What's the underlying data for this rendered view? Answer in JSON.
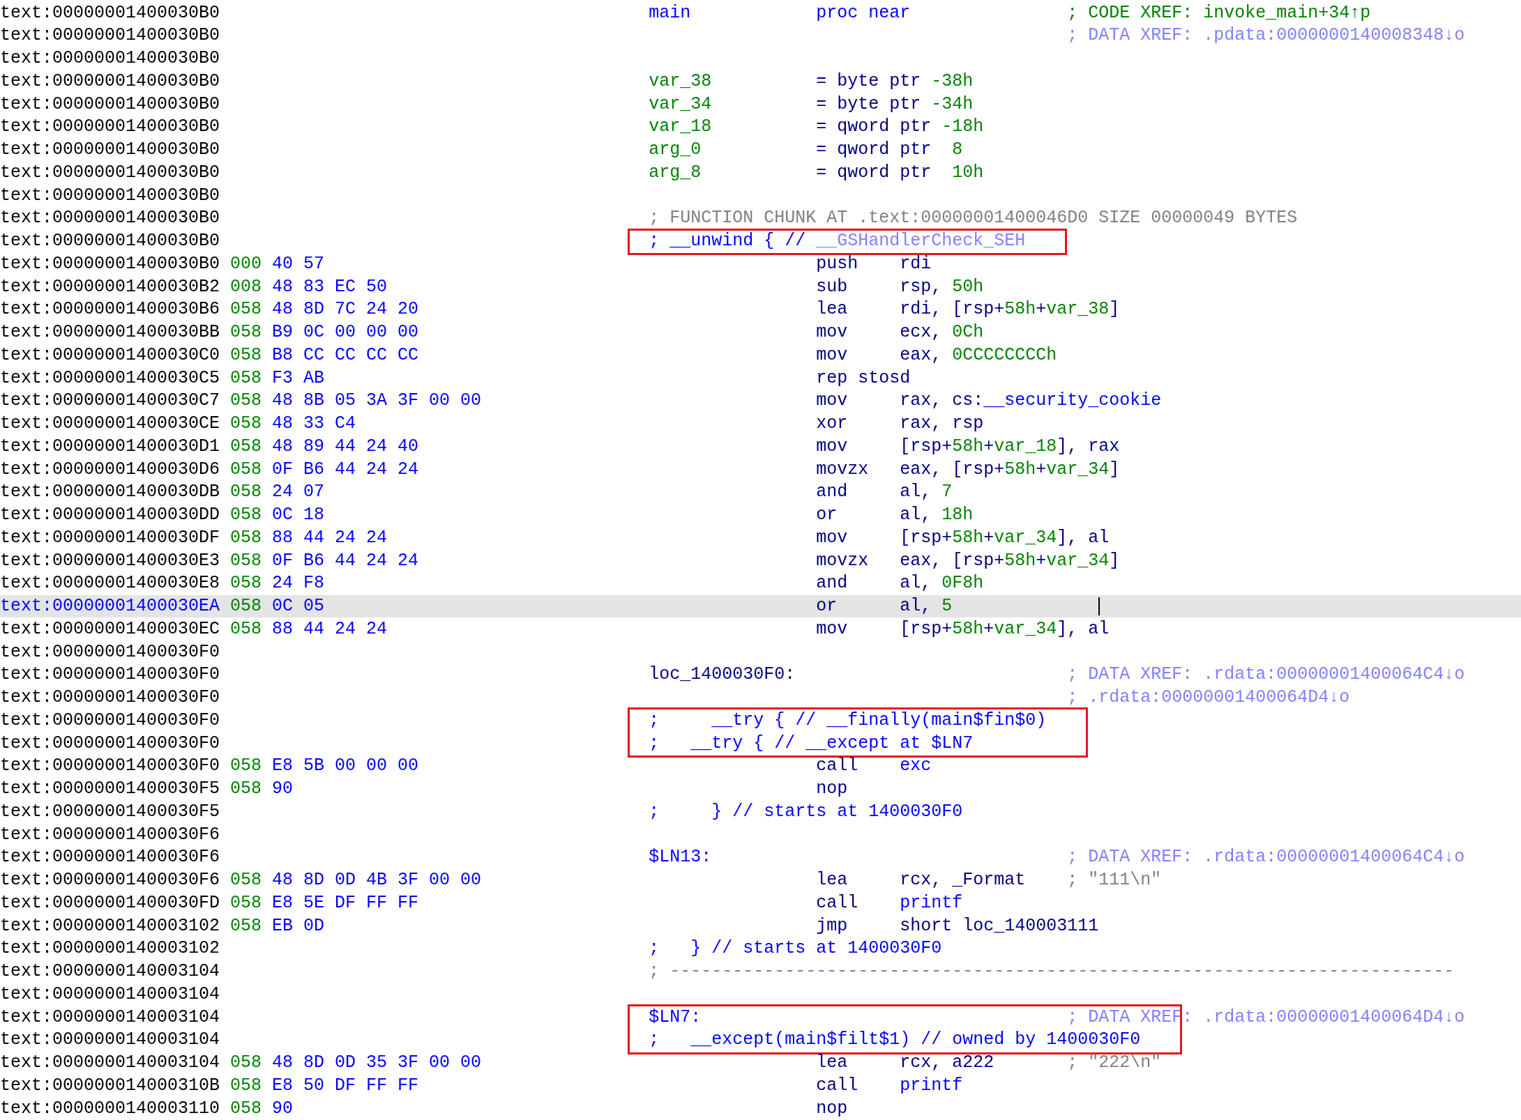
{
  "rows": [
    {
      "address": "text:00000001400030B0",
      "label": [
        {
          "text": "main",
          "kind": "name"
        }
      ],
      "operands": [
        {
          "text": "proc near",
          "kind": "name"
        }
      ],
      "comment": [
        {
          "text": "; CODE XREF: invoke_main+34↑p",
          "kind": "num"
        }
      ],
      "selected": false,
      "boxed": false
    },
    {
      "address": "text:00000001400030B0",
      "comment": [
        {
          "text": "; DATA XREF: .pdata:0000000140008348↓o",
          "kind": "xref"
        }
      ],
      "selected": false,
      "boxed": false
    },
    {
      "address": "text:00000001400030B0",
      "selected": false,
      "boxed": false
    },
    {
      "address": "text:00000001400030B0",
      "label": [
        {
          "text": "var_38",
          "kind": "num"
        }
      ],
      "operands": [
        {
          "text": "= byte ptr ",
          "kind": "plain"
        },
        {
          "text": "-38h",
          "kind": "num"
        }
      ],
      "selected": false,
      "boxed": false
    },
    {
      "address": "text:00000001400030B0",
      "label": [
        {
          "text": "var_34",
          "kind": "num"
        }
      ],
      "operands": [
        {
          "text": "= byte ptr ",
          "kind": "plain"
        },
        {
          "text": "-34h",
          "kind": "num"
        }
      ],
      "selected": false,
      "boxed": false
    },
    {
      "address": "text:00000001400030B0",
      "label": [
        {
          "text": "var_18",
          "kind": "num"
        }
      ],
      "operands": [
        {
          "text": "= qword ptr ",
          "kind": "plain"
        },
        {
          "text": "-18h",
          "kind": "num"
        }
      ],
      "selected": false,
      "boxed": false
    },
    {
      "address": "text:00000001400030B0",
      "label": [
        {
          "text": "arg_0",
          "kind": "num"
        }
      ],
      "operands": [
        {
          "text": "= qword ptr  ",
          "kind": "plain"
        },
        {
          "text": "8",
          "kind": "num"
        }
      ],
      "selected": false,
      "boxed": false
    },
    {
      "address": "text:00000001400030B0",
      "label": [
        {
          "text": "arg_8",
          "kind": "num"
        }
      ],
      "operands": [
        {
          "text": "= qword ptr  ",
          "kind": "plain"
        },
        {
          "text": "10h",
          "kind": "num"
        }
      ],
      "selected": false,
      "boxed": false
    },
    {
      "address": "text:00000001400030B0",
      "selected": false,
      "boxed": false
    },
    {
      "address": "text:00000001400030B0",
      "label": [
        {
          "text": "; FUNCTION CHUNK AT .text:00000001400046D0 SIZE 00000049 BYTES",
          "kind": "gray"
        }
      ],
      "selected": false,
      "boxed": false
    },
    {
      "address": "text:00000001400030B0",
      "label": [
        {
          "text": "; __unwind { // ",
          "kind": "name"
        },
        {
          "text": "__GSHandlerCheck_SEH",
          "kind": "xref"
        }
      ],
      "selected": false,
      "boxed": true
    },
    {
      "address": "text:00000001400030B0",
      "stack": "000",
      "bytes": "40 57",
      "mnemonic": "push",
      "operands": [
        {
          "text": "rdi",
          "kind": "plain"
        }
      ],
      "selected": false,
      "boxed": false
    },
    {
      "address": "text:00000001400030B2",
      "stack": "008",
      "bytes": "48 83 EC 50",
      "mnemonic": "sub",
      "operands": [
        {
          "text": "rsp, ",
          "kind": "plain"
        },
        {
          "text": "50h",
          "kind": "num"
        }
      ],
      "selected": false,
      "boxed": false
    },
    {
      "address": "text:00000001400030B6",
      "stack": "058",
      "bytes": "48 8D 7C 24 20",
      "mnemonic": "lea",
      "operands": [
        {
          "text": "rdi, [rsp+",
          "kind": "plain"
        },
        {
          "text": "58h",
          "kind": "num"
        },
        {
          "text": "+",
          "kind": "plain"
        },
        {
          "text": "var_38",
          "kind": "num"
        },
        {
          "text": "]",
          "kind": "plain"
        }
      ],
      "selected": false,
      "boxed": false
    },
    {
      "address": "text:00000001400030BB",
      "stack": "058",
      "bytes": "B9 0C 00 00 00",
      "mnemonic": "mov",
      "operands": [
        {
          "text": "ecx, ",
          "kind": "plain"
        },
        {
          "text": "0Ch",
          "kind": "num"
        }
      ],
      "selected": false,
      "boxed": false
    },
    {
      "address": "text:00000001400030C0",
      "stack": "058",
      "bytes": "B8 CC CC CC CC",
      "mnemonic": "mov",
      "operands": [
        {
          "text": "eax, ",
          "kind": "plain"
        },
        {
          "text": "0CCCCCCCCh",
          "kind": "num"
        }
      ],
      "selected": false,
      "boxed": false
    },
    {
      "address": "text:00000001400030C5",
      "stack": "058",
      "bytes": "F3 AB",
      "mnemonic": "rep stosd",
      "selected": false,
      "boxed": false
    },
    {
      "address": "text:00000001400030C7",
      "stack": "058",
      "bytes": "48 8B 05 3A 3F 00 00",
      "mnemonic": "mov",
      "operands": [
        {
          "text": "rax, cs:",
          "kind": "plain"
        },
        {
          "text": "__security_cookie",
          "kind": "name"
        }
      ],
      "selected": false,
      "boxed": false
    },
    {
      "address": "text:00000001400030CE",
      "stack": "058",
      "bytes": "48 33 C4",
      "mnemonic": "xor",
      "operands": [
        {
          "text": "rax, rsp",
          "kind": "plain"
        }
      ],
      "selected": false,
      "boxed": false
    },
    {
      "address": "text:00000001400030D1",
      "stack": "058",
      "bytes": "48 89 44 24 40",
      "mnemonic": "mov",
      "operands": [
        {
          "text": "[rsp+",
          "kind": "plain"
        },
        {
          "text": "58h",
          "kind": "num"
        },
        {
          "text": "+",
          "kind": "plain"
        },
        {
          "text": "var_18",
          "kind": "num"
        },
        {
          "text": "], rax",
          "kind": "plain"
        }
      ],
      "selected": false,
      "boxed": false
    },
    {
      "address": "text:00000001400030D6",
      "stack": "058",
      "bytes": "0F B6 44 24 24",
      "mnemonic": "movzx",
      "operands": [
        {
          "text": "eax, [rsp+",
          "kind": "plain"
        },
        {
          "text": "58h",
          "kind": "num"
        },
        {
          "text": "+",
          "kind": "plain"
        },
        {
          "text": "var_34",
          "kind": "num"
        },
        {
          "text": "]",
          "kind": "plain"
        }
      ],
      "selected": false,
      "boxed": false
    },
    {
      "address": "text:00000001400030DB",
      "stack": "058",
      "bytes": "24 07",
      "mnemonic": "and",
      "operands": [
        {
          "text": "al, ",
          "kind": "plain"
        },
        {
          "text": "7",
          "kind": "num"
        }
      ],
      "selected": false,
      "boxed": false
    },
    {
      "address": "text:00000001400030DD",
      "stack": "058",
      "bytes": "0C 18",
      "mnemonic": "or",
      "operands": [
        {
          "text": "al, ",
          "kind": "plain"
        },
        {
          "text": "18h",
          "kind": "num"
        }
      ],
      "selected": false,
      "boxed": false
    },
    {
      "address": "text:00000001400030DF",
      "stack": "058",
      "bytes": "88 44 24 24",
      "mnemonic": "mov",
      "operands": [
        {
          "text": "[rsp+",
          "kind": "plain"
        },
        {
          "text": "58h",
          "kind": "num"
        },
        {
          "text": "+",
          "kind": "plain"
        },
        {
          "text": "var_34",
          "kind": "num"
        },
        {
          "text": "], al",
          "kind": "plain"
        }
      ],
      "selected": false,
      "boxed": false
    },
    {
      "address": "text:00000001400030E3",
      "stack": "058",
      "bytes": "0F B6 44 24 24",
      "mnemonic": "movzx",
      "operands": [
        {
          "text": "eax, [rsp+",
          "kind": "plain"
        },
        {
          "text": "58h",
          "kind": "num"
        },
        {
          "text": "+",
          "kind": "plain"
        },
        {
          "text": "var_34",
          "kind": "num"
        },
        {
          "text": "]",
          "kind": "plain"
        }
      ],
      "selected": false,
      "boxed": false
    },
    {
      "address": "text:00000001400030E8",
      "stack": "058",
      "bytes": "24 F8",
      "mnemonic": "and",
      "operands": [
        {
          "text": "al, ",
          "kind": "plain"
        },
        {
          "text": "0F8h",
          "kind": "num"
        }
      ],
      "selected": false,
      "boxed": false
    },
    {
      "address": "text:00000001400030EA",
      "stack": "058",
      "bytes": "0C 05",
      "mnemonic": "or",
      "operands": [
        {
          "text": "al, ",
          "kind": "plain"
        },
        {
          "text": "5",
          "kind": "num"
        }
      ],
      "selected": true,
      "boxed": false
    },
    {
      "address": "text:00000001400030EC",
      "stack": "058",
      "bytes": "88 44 24 24",
      "mnemonic": "mov",
      "operands": [
        {
          "text": "[rsp+",
          "kind": "plain"
        },
        {
          "text": "58h",
          "kind": "num"
        },
        {
          "text": "+",
          "kind": "plain"
        },
        {
          "text": "var_34",
          "kind": "num"
        },
        {
          "text": "], al",
          "kind": "plain"
        }
      ],
      "selected": false,
      "boxed": false
    },
    {
      "address": "text:00000001400030F0",
      "selected": false,
      "boxed": false
    },
    {
      "address": "text:00000001400030F0",
      "label": [
        {
          "text": "loc_1400030F0:",
          "kind": "plain"
        }
      ],
      "comment": [
        {
          "text": "; DATA XREF: .rdata:00000001400064C4↓o",
          "kind": "xref"
        }
      ],
      "selected": false,
      "boxed": false
    },
    {
      "address": "text:00000001400030F0",
      "comment": [
        {
          "text": "; .rdata:00000001400064D4↓o",
          "kind": "xref"
        }
      ],
      "selected": false,
      "boxed": false
    },
    {
      "address": "text:00000001400030F0",
      "label": [
        {
          "text": ";     __try { // __finally(main$fin$0)",
          "kind": "name"
        }
      ],
      "selected": false,
      "boxed": true
    },
    {
      "address": "text:00000001400030F0",
      "label": [
        {
          "text": ";   __try { // __except at $LN7",
          "kind": "name"
        }
      ],
      "selected": false,
      "boxed": true
    },
    {
      "address": "text:00000001400030F0",
      "stack": "058",
      "bytes": "E8 5B 00 00 00",
      "mnemonic": "call",
      "operands": [
        {
          "text": "exc",
          "kind": "name"
        }
      ],
      "selected": false,
      "boxed": false
    },
    {
      "address": "text:00000001400030F5",
      "stack": "058",
      "bytes": "90",
      "mnemonic": "nop",
      "selected": false,
      "boxed": false
    },
    {
      "address": "text:00000001400030F5",
      "label": [
        {
          "text": ";     } // starts at 1400030F0",
          "kind": "name"
        }
      ],
      "selected": false,
      "boxed": false
    },
    {
      "address": "text:00000001400030F6",
      "selected": false,
      "boxed": false
    },
    {
      "address": "text:00000001400030F6",
      "label": [
        {
          "text": "$LN13:",
          "kind": "name"
        }
      ],
      "comment": [
        {
          "text": "; DATA XREF: .rdata:00000001400064C4↓o",
          "kind": "xref"
        }
      ],
      "selected": false,
      "boxed": false
    },
    {
      "address": "text:00000001400030F6",
      "stack": "058",
      "bytes": "48 8D 0D 4B 3F 00 00",
      "mnemonic": "lea",
      "operands": [
        {
          "text": "rcx, _Format",
          "kind": "plain"
        }
      ],
      "comment": [
        {
          "text": "; \"111\\n\"",
          "kind": "gray"
        }
      ],
      "selected": false,
      "boxed": false
    },
    {
      "address": "text:00000001400030FD",
      "stack": "058",
      "bytes": "E8 5E DF FF FF",
      "mnemonic": "call",
      "operands": [
        {
          "text": "printf",
          "kind": "name"
        }
      ],
      "selected": false,
      "boxed": false
    },
    {
      "address": "text:0000000140003102",
      "stack": "058",
      "bytes": "EB 0D",
      "mnemonic": "jmp",
      "operands": [
        {
          "text": "short loc_140003111",
          "kind": "plain"
        }
      ],
      "selected": false,
      "boxed": false
    },
    {
      "address": "text:0000000140003102",
      "label": [
        {
          "text": ";   } // starts at 1400030F0",
          "kind": "name"
        }
      ],
      "selected": false,
      "boxed": false
    },
    {
      "address": "text:0000000140003104",
      "label": [
        {
          "text": "; ---------------------------------------------------------------------------",
          "kind": "gray"
        }
      ],
      "selected": false,
      "boxed": false
    },
    {
      "address": "text:0000000140003104",
      "selected": false,
      "boxed": false
    },
    {
      "address": "text:0000000140003104",
      "label": [
        {
          "text": "$LN7:",
          "kind": "name"
        }
      ],
      "comment": [
        {
          "text": "; DATA XREF: .rdata:00000001400064D4↓o",
          "kind": "xref"
        }
      ],
      "selected": false,
      "boxed": true
    },
    {
      "address": "text:0000000140003104",
      "label": [
        {
          "text": ";   __except(main$filt$1) // owned by 1400030F0",
          "kind": "name"
        }
      ],
      "selected": false,
      "boxed": true
    },
    {
      "address": "text:0000000140003104",
      "stack": "058",
      "bytes": "48 8D 0D 35 3F 00 00",
      "mnemonic": "lea",
      "operands": [
        {
          "text": "rcx, a222",
          "kind": "plain"
        }
      ],
      "comment": [
        {
          "text": "; \"222\\n\"",
          "kind": "gray"
        }
      ],
      "selected": false,
      "boxed": false
    },
    {
      "address": "text:000000014000310B",
      "stack": "058",
      "bytes": "E8 50 DF FF FF",
      "mnemonic": "call",
      "operands": [
        {
          "text": "printf",
          "kind": "name"
        }
      ],
      "selected": false,
      "boxed": false
    },
    {
      "address": "text:0000000140003110",
      "stack": "058",
      "bytes": "90",
      "mnemonic": "nop",
      "selected": false,
      "boxed": false
    }
  ]
}
